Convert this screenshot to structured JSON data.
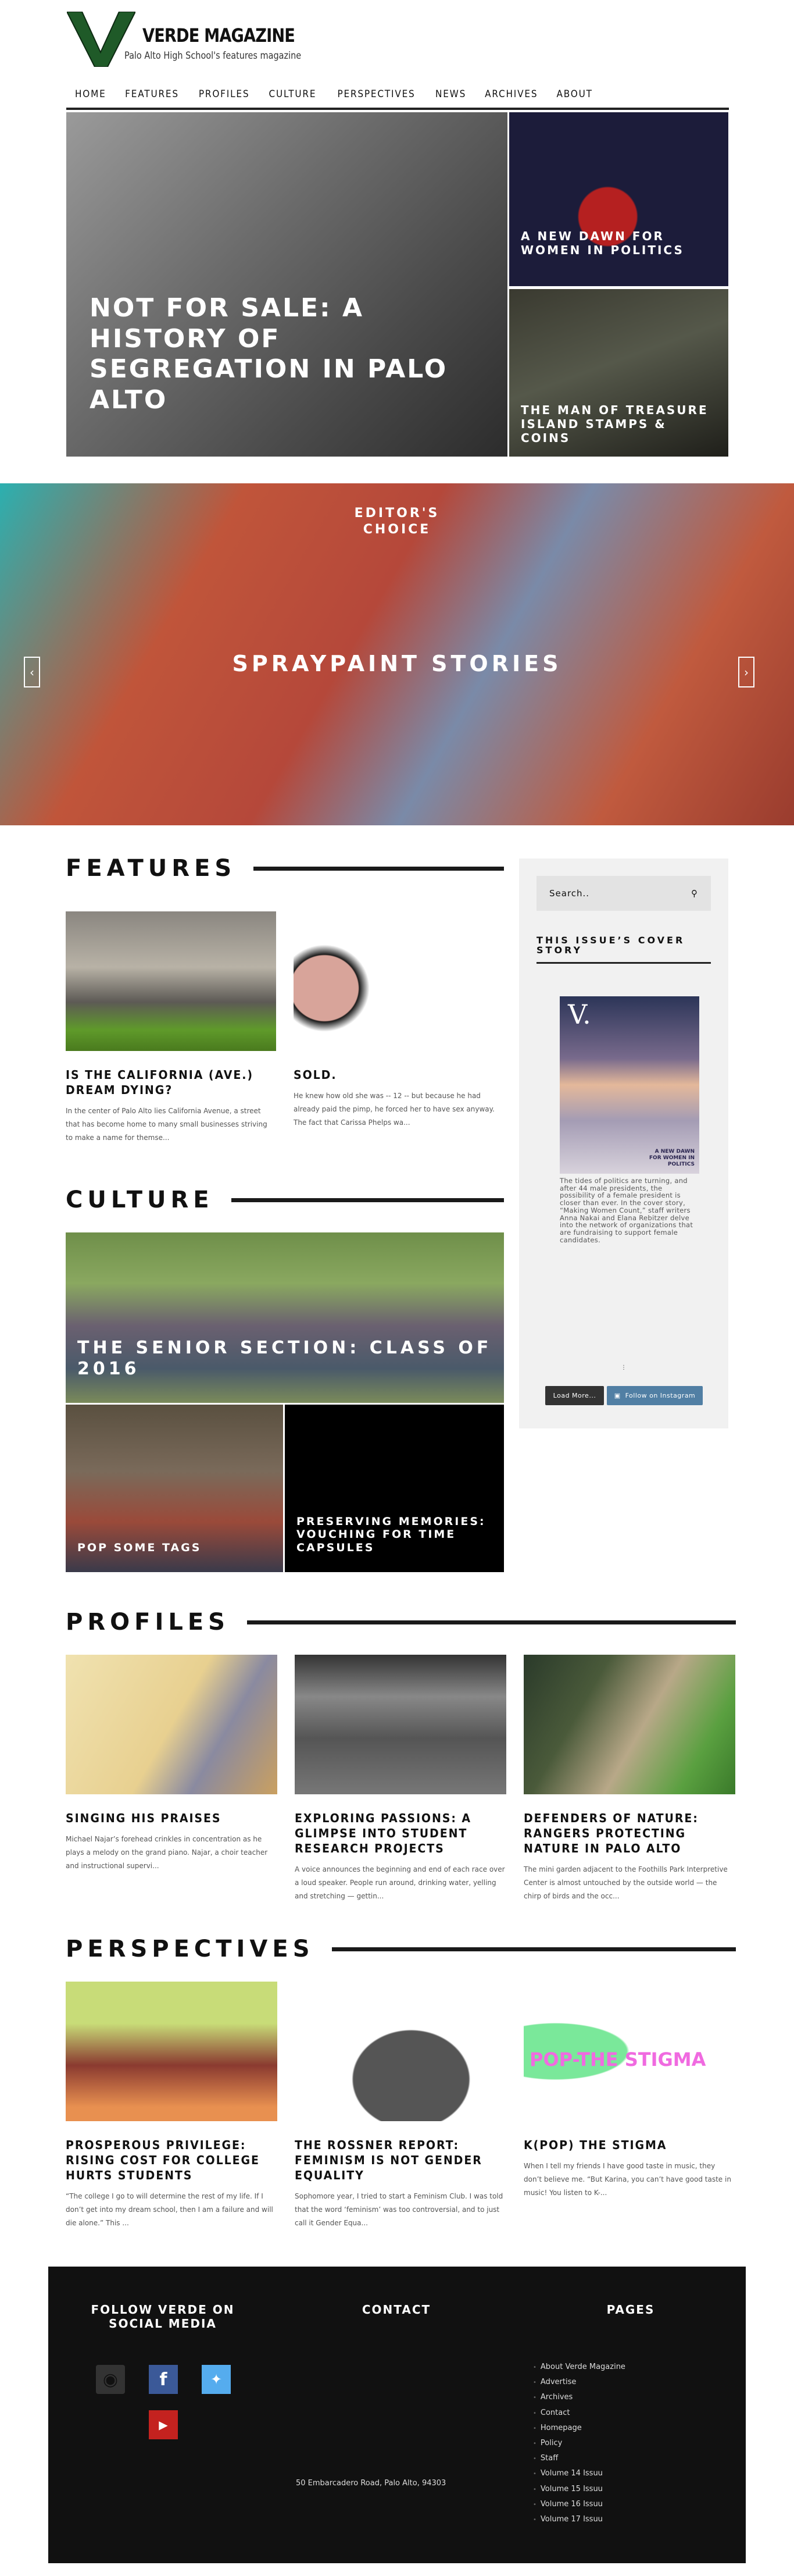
{
  "header": {
    "brand": "VERDE MAGAZINE",
    "tagline": "Palo Alto High School's features magazine",
    "logo_letter": "V"
  },
  "nav": [
    "HOME",
    "FEATURES",
    "PROFILES",
    "CULTURE",
    "PERSPECTIVES",
    "NEWS",
    "ARCHIVES",
    "ABOUT"
  ],
  "hero": [
    {
      "title": "NOT FOR SALE: A HISTORY OF SEGREGATION IN PALO ALTO"
    },
    {
      "title": "A NEW DAWN FOR WOMEN IN POLITICS"
    },
    {
      "title": "THE MAN OF TREASURE ISLAND STAMPS & COINS"
    }
  ],
  "banner": {
    "label": "EDITOR'S CHOICE",
    "title": "SPRAYPAINT STORIES",
    "prev": "‹",
    "next": "›"
  },
  "features": {
    "heading": "FEATURES",
    "items": [
      {
        "title": "IS THE CALIFORNIA (AVE.) DREAM DYING?",
        "excerpt": "In the center of Palo Alto lies California Avenue, a street that has become home to many small businesses striving to make a name for themse..."
      },
      {
        "title": "SOLD.",
        "excerpt": "He knew how old she was -- 12 -- but because he had already paid the pimp, he forced her to have sex anyway. The fact that Carissa Phelps wa..."
      }
    ]
  },
  "sidebar": {
    "search_placeholder": "Search..",
    "cover_heading": "THIS ISSUE’S COVER STORY",
    "cover_image_text": "A NEW DAWN FOR WOMEN IN POLITICS",
    "cover_text": "The tides of politics are turning, and after 44 male presidents, the possibility of a female president is closer than ever. In the cover story, “Making Women Count,” staff writers Anna Nakai and Elana Rebitzer delve into the network of organizations that are fundraising to support female candidates.",
    "load_more": "Load More...",
    "follow_instagram": "Follow on Instagram"
  },
  "culture": {
    "heading": "CULTURE",
    "items": [
      {
        "title": "THE SENIOR SECTION: CLASS OF 2016"
      },
      {
        "title": "POP SOME TAGS"
      },
      {
        "title": "PRESERVING MEMORIES: VOUCHING FOR TIME CAPSULES"
      }
    ]
  },
  "profiles": {
    "heading": "PROFILES",
    "items": [
      {
        "title": "SINGING HIS PRAISES",
        "excerpt": "Michael Najar’s forehead crinkles in concentration as he plays a melody on the grand piano. Najar, a choir teacher and instructional supervi..."
      },
      {
        "title": "EXPLORING PASSIONS: A GLIMPSE INTO STUDENT RESEARCH PROJECTS",
        "excerpt": "A voice announces the beginning and end of each race over a loud speaker. People run around, drinking water, yelling and stretching — gettin..."
      },
      {
        "title": "DEFENDERS OF NATURE: RANGERS PROTECTING NATURE IN PALO ALTO",
        "excerpt": "The mini garden adjacent to the Foothills Park Interpretive Center is almost untouched by the outside world — the chirp of birds and the occ..."
      }
    ]
  },
  "perspectives": {
    "heading": "PERSPECTIVES",
    "items": [
      {
        "title": "PROSPEROUS PRIVILEGE: RISING COST FOR COLLEGE HURTS STUDENTS",
        "excerpt": "“The college I go to will determine the rest of my life. If I don’t get into my dream school, then I am a failure and will die alone.” This ..."
      },
      {
        "title": "THE ROSSNER REPORT: FEMINISM IS NOT GENDER EQUALITY",
        "excerpt": "Sophomore year, I tried to start a Feminism Club. I was told that the word ‘feminism’ was too controversial, and to just call it Gender Equa..."
      },
      {
        "title": "K(POP) THE STIGMA",
        "excerpt": "When I tell my friends I have good taste in music, they don’t believe me. “But Karina, you can’t have good taste in music! You listen to K-..."
      }
    ],
    "kpop_image_text": "POP-THE STIGMA"
  },
  "footer": {
    "social_heading": "FOLLOW VERDE ON SOCIAL MEDIA",
    "contact_heading": "CONTACT",
    "pages_heading": "PAGES",
    "address": "50 Embarcadero Road, Palo Alto, 94303",
    "pages": [
      "About Verde Magazine",
      "Advertise",
      "Archives",
      "Contact",
      "Homepage",
      "Policy",
      "Staff",
      "Volume 14 Issuu",
      "Volume 15 Issuu",
      "Volume 16 Issuu",
      "Volume 17 Issuu"
    ]
  }
}
